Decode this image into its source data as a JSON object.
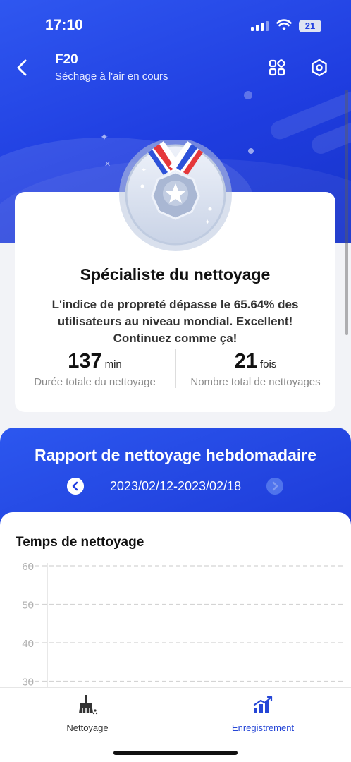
{
  "status_bar": {
    "time": "17:10",
    "battery": "21"
  },
  "header": {
    "title": "F20",
    "subtitle": "Séchage à l'air en cours"
  },
  "achievement": {
    "title": "Spécialiste du nettoyage",
    "description": "L'indice de propreté dépasse le 65.64% des utilisateurs au niveau mondial. Excellent! Continuez comme ça!",
    "stats": [
      {
        "value": "137",
        "unit": "min",
        "label": "Durée totale du nettoyage"
      },
      {
        "value": "21",
        "unit": "fois",
        "label": "Nombre total de nettoyages"
      }
    ]
  },
  "weekly": {
    "title": "Rapport de nettoyage hebdomadaire",
    "date_range": "2023/02/12-2023/02/18"
  },
  "chart_data": {
    "type": "bar",
    "title": "Temps de nettoyage",
    "y_ticks": [
      "60",
      "50",
      "40",
      "30"
    ],
    "ylim": [
      30,
      60
    ],
    "grid": true
  },
  "tabs": [
    {
      "label": "Nettoyage",
      "active": false
    },
    {
      "label": "Enregistrement",
      "active": true
    }
  ],
  "colors": {
    "primary": "#2240df",
    "active_tab": "#2546d6"
  }
}
